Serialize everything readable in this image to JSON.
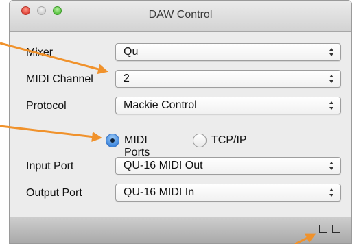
{
  "window": {
    "title": "DAW Control",
    "controls": [
      "close",
      "minimize",
      "zoom"
    ]
  },
  "form": {
    "mixer": {
      "label": "Mixer",
      "value": "Qu"
    },
    "midi_channel": {
      "label": "MIDI Channel",
      "value": "2"
    },
    "protocol": {
      "label": "Protocol",
      "value": "Mackie Control"
    },
    "connection": {
      "options": [
        {
          "label": "MIDI Ports",
          "selected": true
        },
        {
          "label": "TCP/IP",
          "selected": false
        }
      ]
    },
    "input_port": {
      "label": "Input Port",
      "value": "QU-16 MIDI Out"
    },
    "output_port": {
      "label": "Output Port",
      "value": "QU-16 MIDI In"
    }
  },
  "status_bar": {
    "icons": [
      "square-icon",
      "square-icon"
    ]
  },
  "colors": {
    "annotation_arrow": "#f0922c",
    "radio_selected": "#3d86dd"
  }
}
